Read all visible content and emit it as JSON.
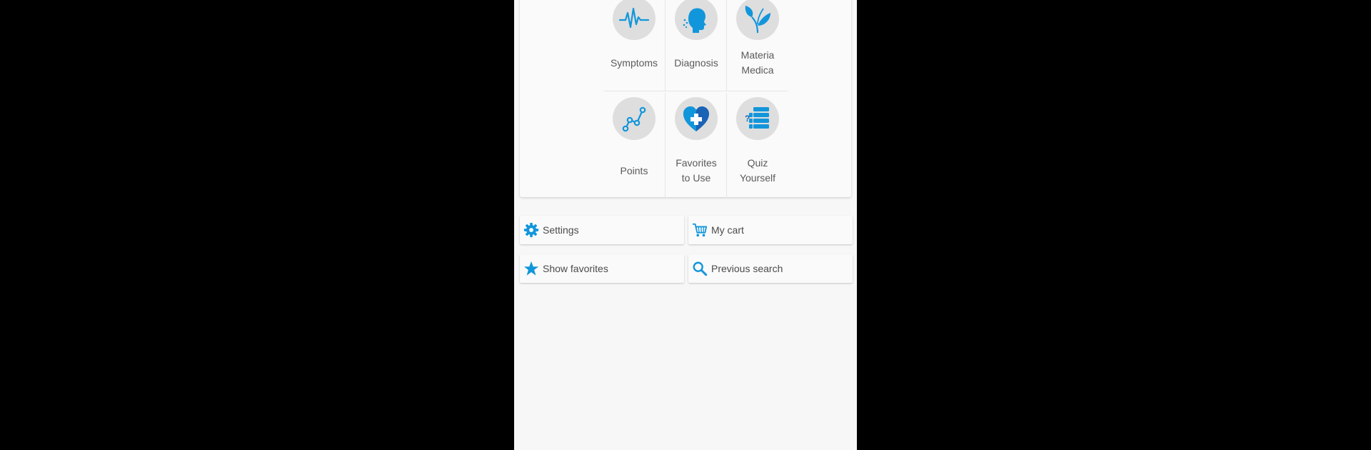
{
  "colors": {
    "accent": "#1296db",
    "icon_circle": "#dedede",
    "label_text": "#5a5a5a",
    "background": "#f7f7f7",
    "letterbox": "#000000"
  },
  "menu": {
    "tiles": [
      {
        "label_line1": "Symptoms",
        "label_line2": "",
        "icon": "heartbeat-pulse-icon"
      },
      {
        "label_line1": "Diagnosis",
        "label_line2": "",
        "icon": "head-profile-icon"
      },
      {
        "label_line1": "Materia",
        "label_line2": "Medica",
        "icon": "plant-leaves-icon"
      },
      {
        "label_line1": "Points",
        "label_line2": "",
        "icon": "connected-points-icon"
      },
      {
        "label_line1": "Favorites",
        "label_line2": "to Use",
        "icon": "heart-plus-icon"
      },
      {
        "label_line1": "Quiz",
        "label_line2": "Yourself",
        "icon": "quiz-list-icon"
      }
    ]
  },
  "actions": {
    "settings": {
      "label": "Settings",
      "icon": "gear-icon"
    },
    "cart": {
      "label": "My cart",
      "icon": "shopping-cart-icon"
    },
    "favorites": {
      "label": "Show favorites",
      "icon": "star-icon"
    },
    "search": {
      "label": "Previous search",
      "icon": "search-icon"
    }
  }
}
